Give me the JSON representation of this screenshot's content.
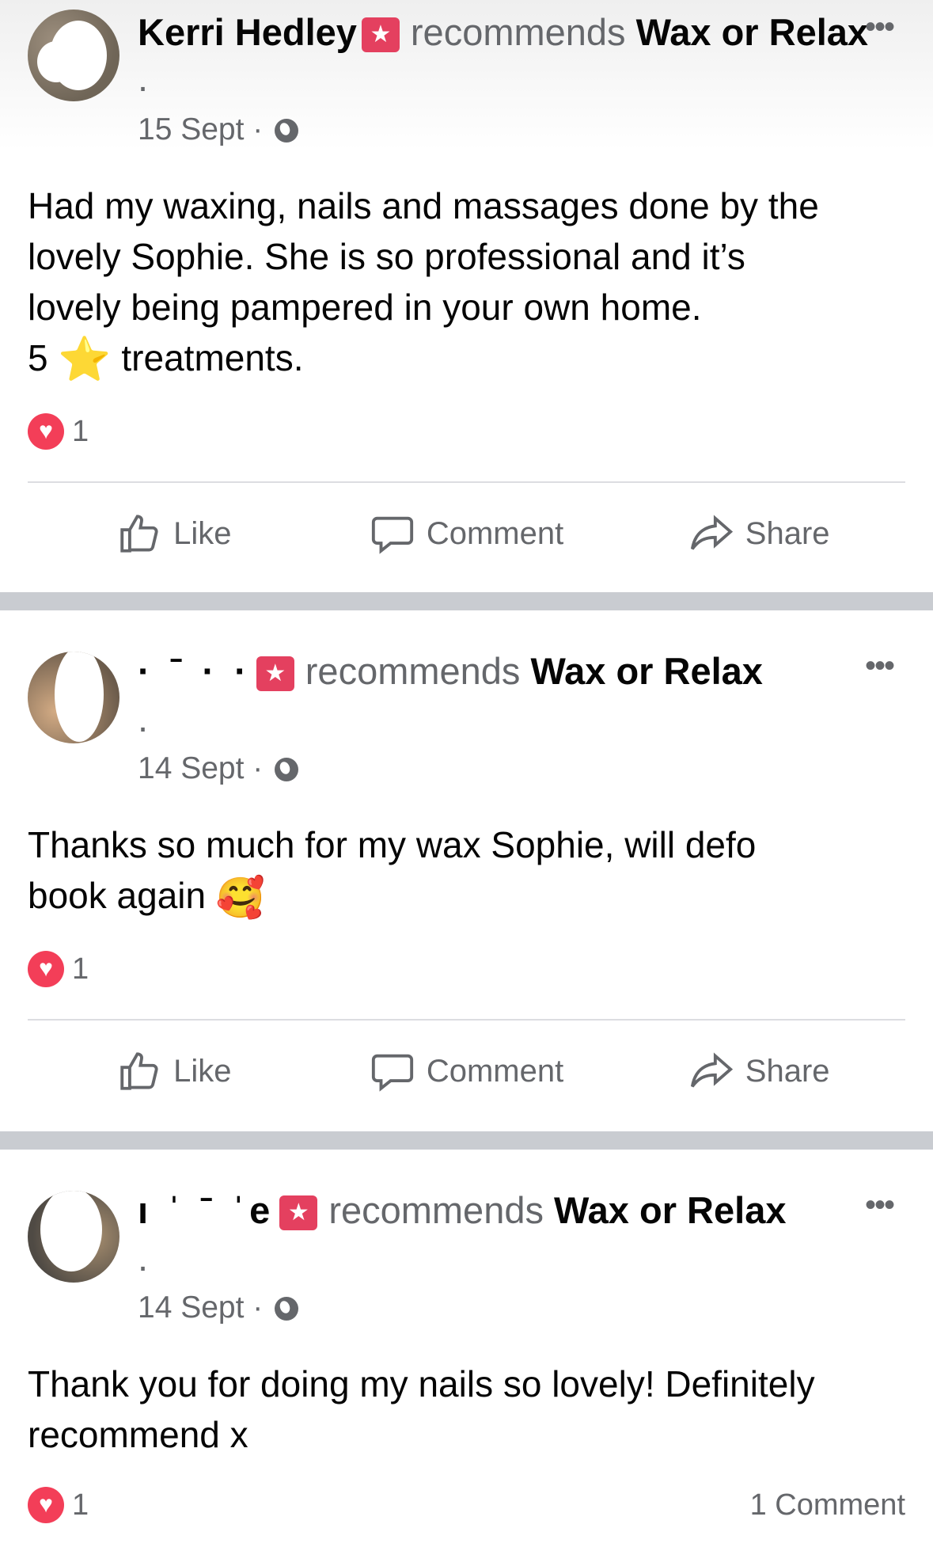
{
  "posts": [
    {
      "author": "Kerri Hedley",
      "redacted_name": "",
      "verb": "recommends",
      "page": "Wax or Relax",
      "period": ".",
      "date": "15 Sept",
      "separator": "·",
      "body_lines": [
        "Had my waxing, nails and massages done by the",
        "lovely Sophie. She is so professional and it’s",
        "lovely being pampered in your own home."
      ],
      "body_last_prefix": "5",
      "body_last_star": "⭐",
      "body_last_suffix": "treatments.",
      "reaction_count": "1",
      "comment_count": ""
    },
    {
      "author": "",
      "redacted_name": "·  ˉ  ·  ·",
      "verb": "recommends",
      "page": "Wax or Relax",
      "period": ".",
      "date": "14 Sept",
      "separator": "·",
      "body_lines": [
        "Thanks so much for my wax Sophie, will defo",
        "book again"
      ],
      "body_emoji": "🥰",
      "reaction_count": "1",
      "comment_count": ""
    },
    {
      "author": "",
      "redacted_name": "ı  ˈ  ˉ  ˈe",
      "verb": "recommends",
      "page": "Wax or Relax",
      "period": ".",
      "date": "14 Sept",
      "separator": "·",
      "body_lines": [
        "Thank you for doing my nails so lovely! Definitely",
        "recommend x"
      ],
      "reaction_count": "1",
      "comment_count": "1 Comment"
    }
  ],
  "actions": {
    "like": "Like",
    "comment": "Comment",
    "share": "Share"
  },
  "icons": {
    "more": "more-dots-icon",
    "globe": "globe-icon",
    "badge": "recommend-badge-icon",
    "heart": "heart-reaction-icon"
  },
  "colors": {
    "badge": "#e4405f",
    "heart": "#f33e58",
    "secondary_text": "#65676b",
    "separator": "#c9ccd1"
  }
}
